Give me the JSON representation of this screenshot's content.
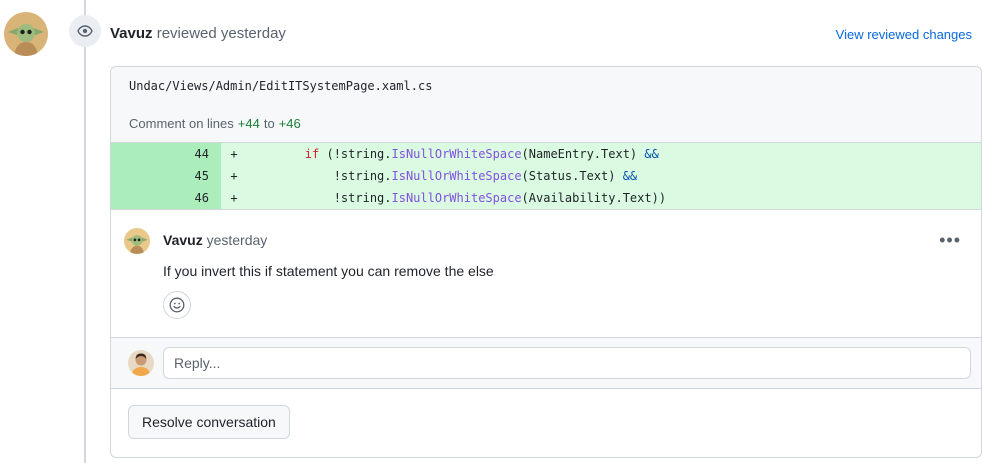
{
  "review": {
    "author": "Vavuz",
    "action": " reviewed yesterday",
    "view_link": "View reviewed changes"
  },
  "file": {
    "path": "Undac/Views/Admin/EditITSystemPage.xaml.cs",
    "comment_prefix": "Comment on lines",
    "line_start": "+44",
    "to": "to",
    "line_end": "+46"
  },
  "diff": [
    {
      "ln": "44",
      "sign": "+",
      "indent": "        ",
      "pre": "if",
      "mid1": " (",
      "neg": "!string.",
      "fn": "IsNullOrWhiteSpace",
      "rest": "(NameEntry.Text) ",
      "op": "&&"
    },
    {
      "ln": "45",
      "sign": "+",
      "indent": "            ",
      "pre": "",
      "mid1": "",
      "neg": "!string.",
      "fn": "IsNullOrWhiteSpace",
      "rest": "(Status.Text) ",
      "op": "&&"
    },
    {
      "ln": "46",
      "sign": "+",
      "indent": "            ",
      "pre": "",
      "mid1": "",
      "neg": "!string.",
      "fn": "IsNullOrWhiteSpace",
      "rest": "(Availability.Text))",
      "op": ""
    }
  ],
  "comment": {
    "author": "Vavuz",
    "time": " yesterday",
    "body": "If you invert this if statement you can remove the else",
    "more": "•••"
  },
  "reply": {
    "placeholder": "Reply..."
  },
  "resolve_label": "Resolve conversation",
  "icons": {
    "eye": "eye-icon",
    "smiley": "smiley-icon",
    "kebab": "kebab-horizontal-icon"
  },
  "colors": {
    "link": "#0969da",
    "added_bg": "#dafbe1",
    "added_num_bg": "#aceebb",
    "line_num_green": "#1a7f37"
  }
}
